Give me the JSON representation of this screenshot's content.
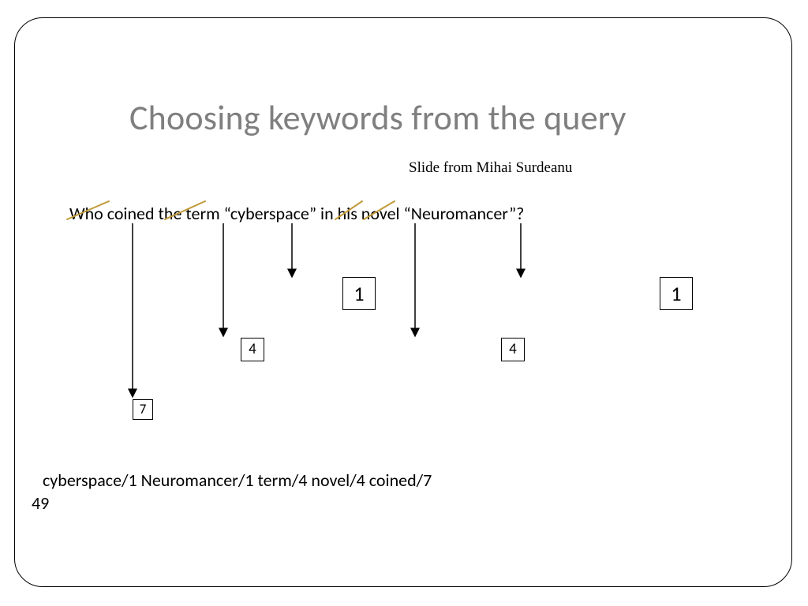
{
  "title": "Choosing keywords from the query",
  "subtitle": "Slide from Mihai Surdeanu",
  "query": "Who coined the term “cyberspace” in his novel “Neuromancer”?",
  "result": "cyberspace/1 Neuromancer/1 term/4 novel/4 coined/7",
  "page_number": "49",
  "boxes": {
    "coined": "7",
    "term": "4",
    "cyberspace": "1",
    "novel": "4",
    "neuromancer": "1"
  }
}
